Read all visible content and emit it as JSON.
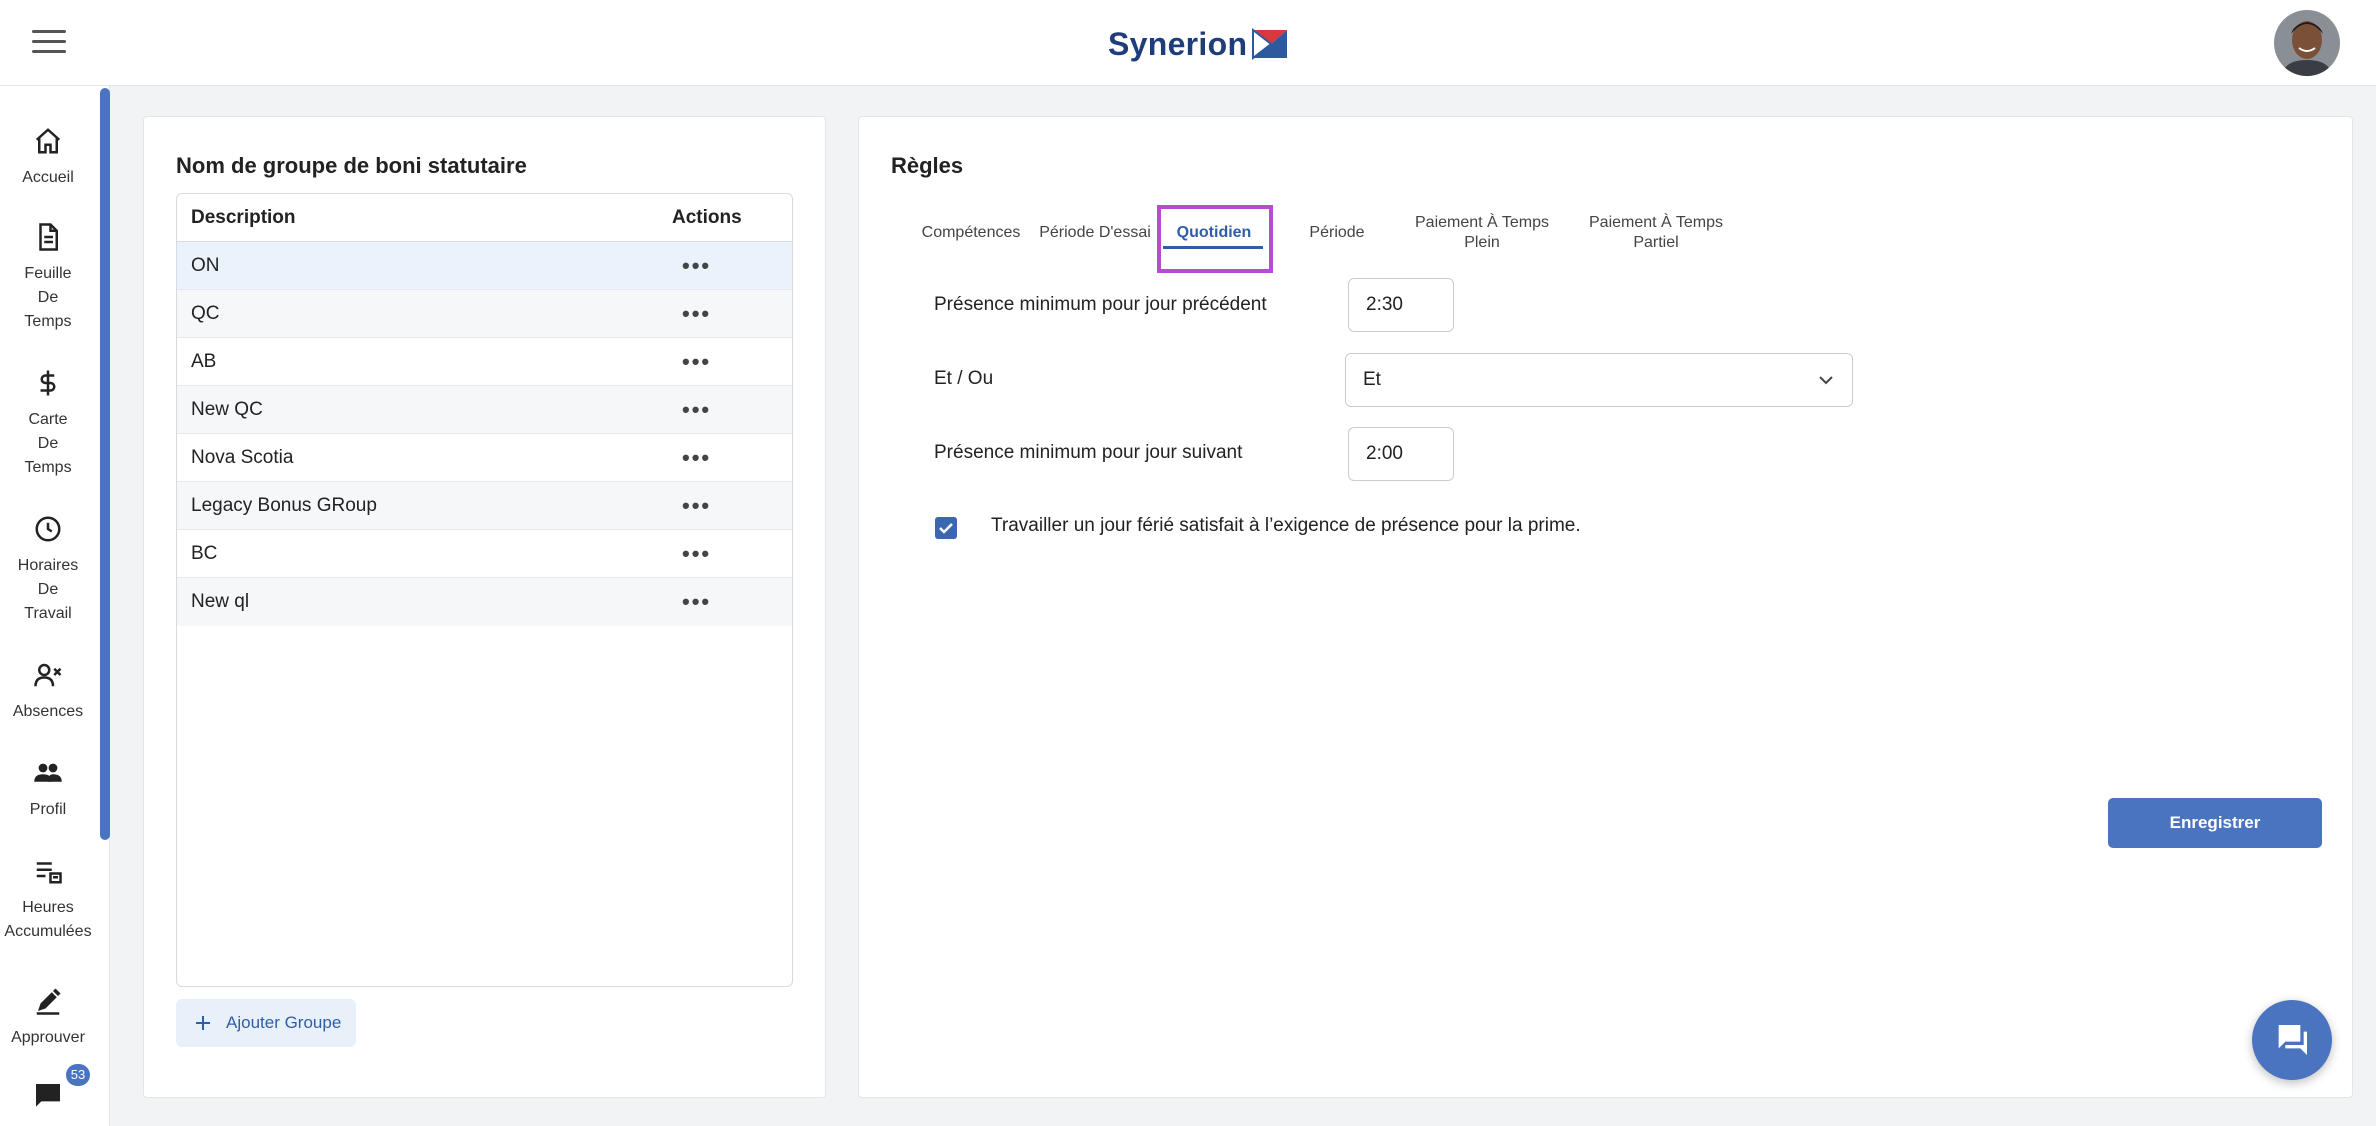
{
  "header": {
    "logo_text": "Synerion",
    "logo_colors": {
      "text": "#1f3d7a",
      "red": "#d9393e",
      "blue": "#2d5a9e"
    }
  },
  "sidebar": {
    "items": [
      {
        "icon": "home-icon",
        "label": "Accueil"
      },
      {
        "icon": "timesheet-icon",
        "label": "Feuille\nDe\nTemps"
      },
      {
        "icon": "dollar-icon",
        "label": "Carte\nDe\nTemps"
      },
      {
        "icon": "clock-icon",
        "label": "Horaires\nDe\nTravail"
      },
      {
        "icon": "user-x-icon",
        "label": "Absences"
      },
      {
        "icon": "people-icon",
        "label": "Profil"
      },
      {
        "icon": "accrual-list-icon",
        "label": "Heures\nAccumulées"
      },
      {
        "icon": "approve-icon",
        "label": "Approuver"
      }
    ],
    "messages_badge": "53"
  },
  "left_panel": {
    "title": "Nom de groupe de boni statutaire",
    "table": {
      "columns": [
        "Description",
        "Actions"
      ],
      "rows": [
        "ON",
        "QC",
        "AB",
        "New QC",
        "Nova Scotia",
        "Legacy Bonus GRoup",
        "BC",
        "New ql"
      ],
      "selected_index": 0,
      "row_action": "•••"
    },
    "add_button": "Ajouter Groupe"
  },
  "right_panel": {
    "title": "Règles",
    "tabs": [
      "Compétences",
      "Période D'essai",
      "Quotidien",
      "Période",
      "Paiement À Temps\nPlein",
      "Paiement À Temps\nPartiel"
    ],
    "active_tab": "Quotidien",
    "form": {
      "min_prev_label": "Présence minimum pour jour précédent",
      "min_prev_value": "2:30",
      "and_or_label": "Et / Ou",
      "and_or_value": "Et",
      "min_next_label": "Présence minimum pour jour suivant",
      "min_next_value": "2:00",
      "holiday_checkbox_checked": true,
      "holiday_checkbox_label": "Travailler un jour férié satisfait à l’exigence de présence pour la prime."
    },
    "save_button": "Enregistrer"
  },
  "colors": {
    "accent": "#4a74c0",
    "highlight": "#b44cd6",
    "selected_row": "#eaf2fb"
  }
}
